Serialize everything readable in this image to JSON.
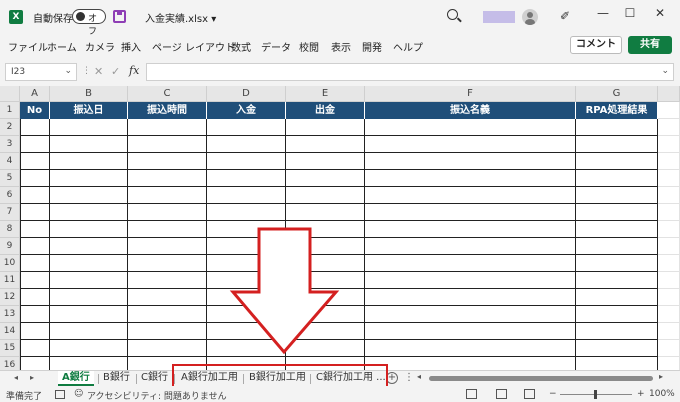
{
  "title_bar": {
    "app_icon": "X",
    "autosave_label": "自動保存",
    "autosave_state": "オフ",
    "filename": "入金実績.xlsx",
    "filename_chevron": "▾",
    "pen_glyph": "✐",
    "minimize": "—",
    "maximize": "☐",
    "close": "✕"
  },
  "menu": {
    "items": [
      "ファイル",
      "ホーム",
      "カメラ",
      "挿入",
      "ページ レイアウト",
      "数式",
      "データ",
      "校閲",
      "表示",
      "開発",
      "ヘルプ"
    ],
    "comment_label": "コメント",
    "share_label": "共有"
  },
  "formula_bar": {
    "name_box": "I23",
    "chevron": "⌄",
    "dots": "⋮",
    "cancel_glyph": "✕",
    "ok_glyph": "✓",
    "fx_label": "fx",
    "formula_value": ""
  },
  "sheet": {
    "columns": [
      "A",
      "B",
      "C",
      "D",
      "E",
      "F",
      "G"
    ],
    "headers": [
      "No",
      "振込日",
      "振込時間",
      "入金",
      "出金",
      "振込名義",
      "RPA処理結果"
    ],
    "rows": [
      "1",
      "2",
      "3",
      "4",
      "5",
      "6",
      "7",
      "8",
      "9",
      "10",
      "11",
      "12",
      "13",
      "14",
      "15",
      "16"
    ],
    "header_color": "#1f4e79"
  },
  "tabs": {
    "nav_prev": "◂",
    "nav_next": "▸",
    "sheets": [
      "A銀行",
      "B銀行",
      "C銀行",
      "A銀行加工用",
      "B銀行加工用",
      "C銀行加工用 ..."
    ],
    "active_sheet": "A銀行",
    "add_sheet": "+",
    "more": "⋮",
    "scroll_left": "◂",
    "scroll_right": "▸"
  },
  "status": {
    "ready": "準備完了",
    "accessibility": "アクセシビリティ: 問題ありません",
    "zoom_minus": "−",
    "zoom_plus": "+",
    "zoom": "100%"
  },
  "annotation": {
    "arrow_color": "#d42020",
    "highlight_color": "#d42020"
  }
}
